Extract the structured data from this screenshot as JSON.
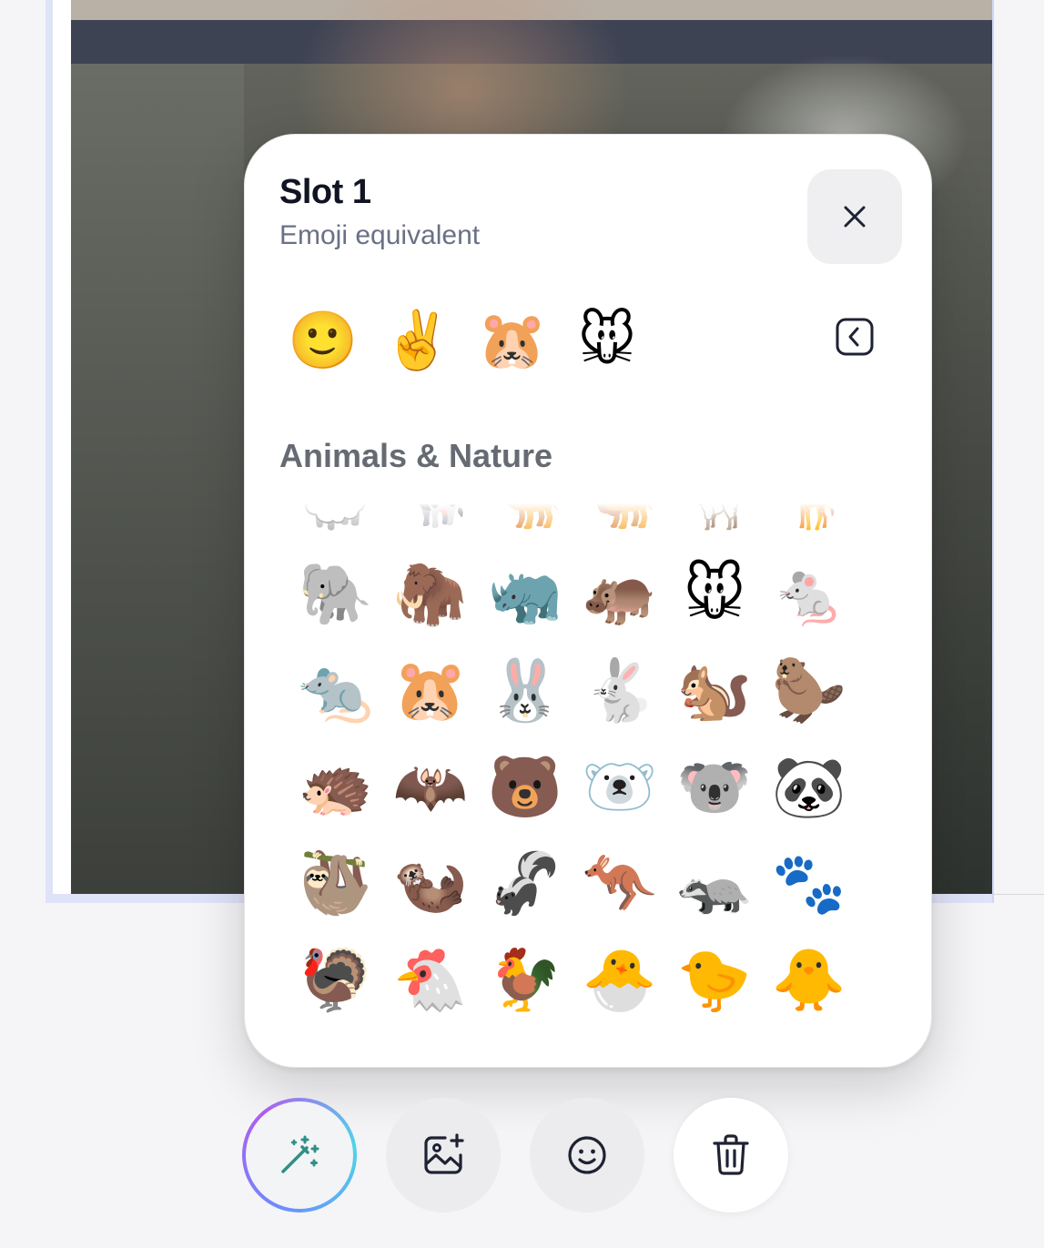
{
  "popup": {
    "title": "Slot 1",
    "subtitle": "Emoji equivalent",
    "close_icon": "close-icon",
    "collapse_icon": "chevron-left-square-icon"
  },
  "recent_emojis": [
    "🙂",
    "✌️",
    "🐹",
    "🐭"
  ],
  "category": {
    "title": "Animals & Nature",
    "rows": [
      [
        "🐑",
        "🐄",
        "🐪",
        "🐫",
        "🦙",
        "🦒"
      ],
      [
        "🐘",
        "🦣",
        "🦏",
        "🦛",
        "🐭",
        "🐁"
      ],
      [
        "🐀",
        "🐹",
        "🐰",
        "🐇",
        "🐿️",
        "🦫"
      ],
      [
        "🦔",
        "🦇",
        "🐻",
        "🐻‍❄️",
        "🐨",
        "🐼"
      ],
      [
        "🦥",
        "🦦",
        "🦨",
        "🦘",
        "🦡",
        "🐾"
      ],
      [
        "🦃",
        "🐔",
        "🐓",
        "🐣",
        "🐤",
        "🐥"
      ]
    ]
  },
  "toolbar": {
    "buttons": [
      {
        "name": "ai-magic-button",
        "icon": "magic-wand-icon"
      },
      {
        "name": "add-image-button",
        "icon": "image-plus-icon"
      },
      {
        "name": "emoji-button",
        "icon": "smiley-icon"
      },
      {
        "name": "delete-button",
        "icon": "trash-icon"
      }
    ]
  },
  "colors": {
    "title": "#111423",
    "subtitle": "#6a7085",
    "category_title": "#666a72",
    "icon_stroke": "#1e2233",
    "ai_icon": "#2f8f86"
  }
}
